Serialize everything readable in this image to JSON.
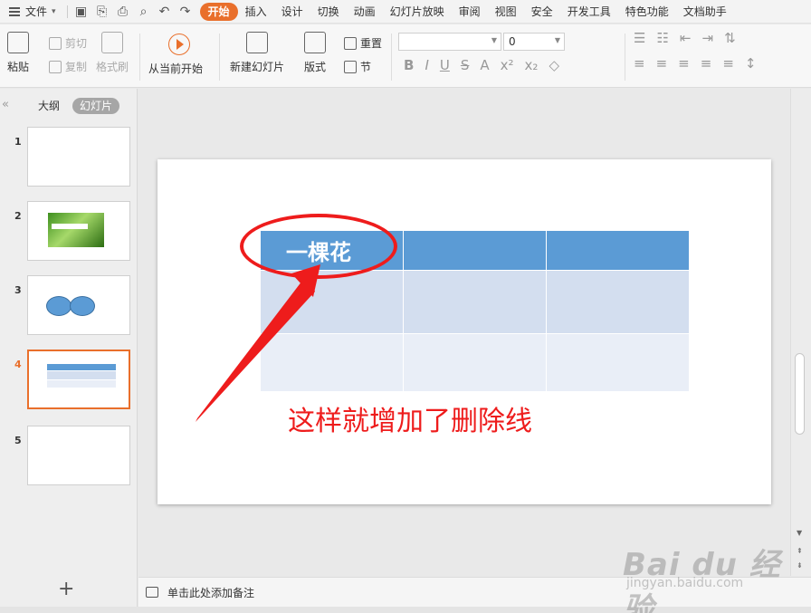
{
  "menubar": {
    "file_label": "文件",
    "tabs": [
      "开始",
      "插入",
      "设计",
      "切换",
      "动画",
      "幻灯片放映",
      "审阅",
      "视图",
      "安全",
      "开发工具",
      "特色功能",
      "文档助手"
    ],
    "active_tab": "开始",
    "accent_color": "#e96f2b"
  },
  "ribbon": {
    "paste": "粘贴",
    "cut": "剪切",
    "copy": "复制",
    "format_painter": "格式刷",
    "from_current": "从当前开始",
    "new_slide": "新建幻灯片",
    "layout": "版式",
    "section": "节",
    "reset": "重置",
    "font_name": "",
    "font_size": "0"
  },
  "leftpanel": {
    "outline_tab": "大纲",
    "slides_tab": "幻灯片",
    "thumbnails": [
      "1",
      "2",
      "3",
      "4",
      "5"
    ],
    "active_slide": "4",
    "add_slide_icon": "plus-icon"
  },
  "slide": {
    "header_cell": "一棵花",
    "annotation_text": "这样就增加了删除线",
    "annotation_color": "#ee1c1c",
    "header_color": "#5b9bd5"
  },
  "notes": {
    "placeholder": "单击此处添加备注"
  },
  "watermark": {
    "logo": "Bai du 经验",
    "sub": "jingyan.baidu.com"
  }
}
